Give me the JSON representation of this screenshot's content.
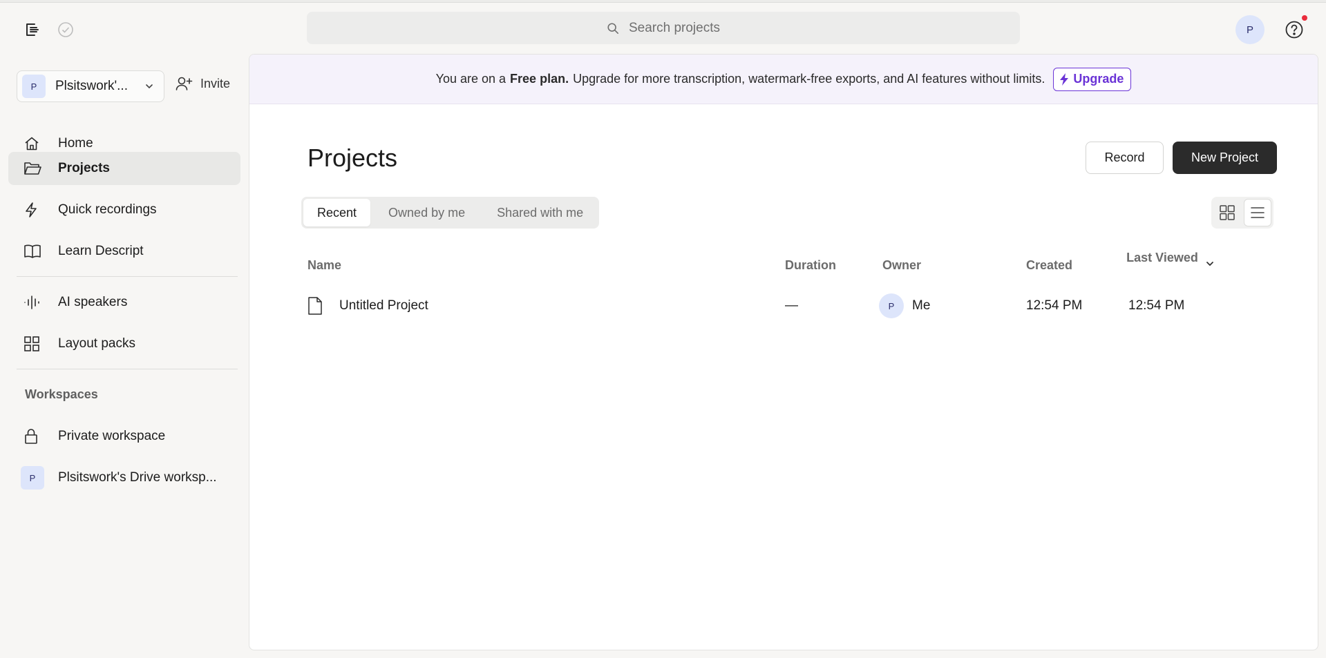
{
  "topbar": {
    "search_placeholder": "Search projects",
    "user_initial": "P"
  },
  "sidebar": {
    "workspace": {
      "initial": "P",
      "name": "Plsitswork'..."
    },
    "invite_label": "Invite",
    "nav": [
      {
        "label": "Home",
        "icon": "home-icon"
      },
      {
        "label": "Projects",
        "icon": "folder-icon",
        "active": true
      },
      {
        "label": "Quick recordings",
        "icon": "bolt-icon"
      },
      {
        "label": "Learn Descript",
        "icon": "book-icon"
      },
      {
        "label": "AI speakers",
        "icon": "waveform-icon"
      },
      {
        "label": "Layout packs",
        "icon": "grid-icon"
      }
    ],
    "workspaces_label": "Workspaces",
    "workspaces": [
      {
        "label": "Private workspace",
        "icon": "lock-icon"
      },
      {
        "label": "Plsitswork's Drive worksp...",
        "initial": "P"
      }
    ]
  },
  "banner": {
    "prefix": "You are on a",
    "plan": "Free plan.",
    "message": "Upgrade for more transcription, watermark-free exports, and AI features without limits.",
    "upgrade_label": "Upgrade",
    "accent": "#6a33d6"
  },
  "main": {
    "title": "Projects",
    "record_label": "Record",
    "new_project_label": "New Project",
    "tabs": [
      "Recent",
      "Owned by me",
      "Shared with me"
    ],
    "active_tab": "Recent",
    "view_modes": [
      "grid-view-icon",
      "list-view-icon"
    ],
    "active_view": "list-view-icon"
  },
  "table": {
    "columns": {
      "name": "Name",
      "duration": "Duration",
      "owner": "Owner",
      "created": "Created",
      "last_viewed": "Last Viewed"
    },
    "rows": [
      {
        "name": "Untitled Project",
        "duration": "—",
        "owner_initial": "P",
        "owner": "Me",
        "created": "12:54 PM",
        "last_viewed": "12:54 PM"
      }
    ]
  }
}
